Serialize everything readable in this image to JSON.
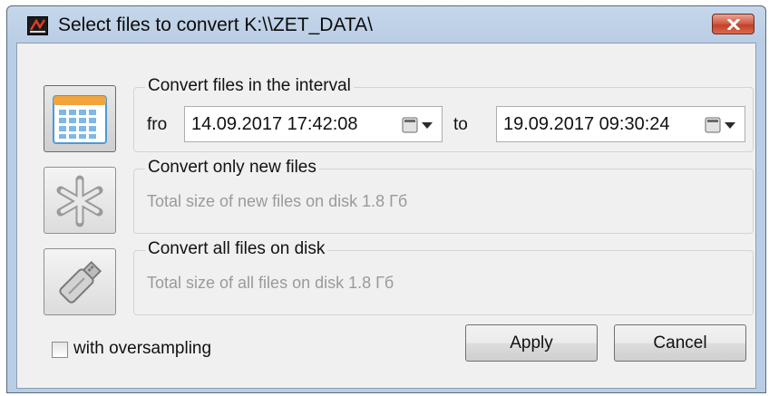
{
  "window": {
    "title": "Select files to convert K:\\\\ZET_DATA\\",
    "close_label": "x"
  },
  "interval": {
    "label": "Convert files in the interval",
    "from_label": "fro",
    "from_value": "14.09.2017 17:42:08",
    "to_label": "to",
    "to_value": "19.09.2017 09:30:24"
  },
  "new_files": {
    "label": "Convert only new files",
    "info": "Total size of new files on disk  1.8 Гб"
  },
  "all_files": {
    "label": "Convert all files on disk",
    "info": "Total size of all files on disk  1.8 Гб"
  },
  "options": {
    "oversampling_label": "with oversampling",
    "oversampling_checked": false
  },
  "buttons": {
    "apply": "Apply",
    "cancel": "Cancel"
  },
  "icons": {
    "app": "app-icon",
    "close": "close-icon",
    "calendar": "calendar-icon",
    "asterisk": "asterisk-icon",
    "usb": "usb-drive-icon",
    "date_picker": "calendar-dropdown-icon"
  },
  "colors": {
    "title_gradient": "#b9cde4",
    "close_red": "#c13f28",
    "calendar_blue": "#4a9ad8",
    "calendar_orange": "#f2a33a",
    "disabled_text": "#9a9a9a"
  }
}
